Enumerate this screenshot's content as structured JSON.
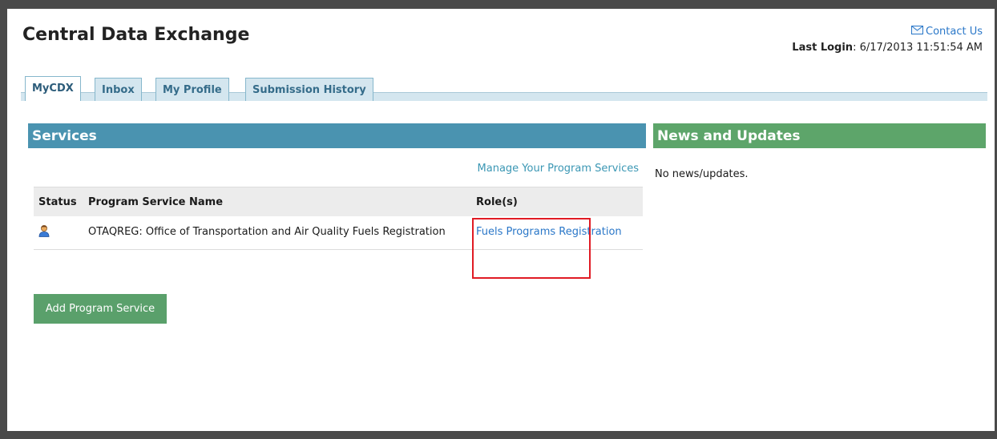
{
  "header": {
    "title": "Central Data Exchange",
    "contact_label": "Contact Us",
    "last_login_label": "Last Login",
    "last_login_value": ": 6/17/2013 11:51:54 AM"
  },
  "tabs": [
    {
      "label": "MyCDX",
      "active": true
    },
    {
      "label": "Inbox",
      "active": false
    },
    {
      "label": "My Profile",
      "active": false
    },
    {
      "label": "Submission History",
      "active": false
    }
  ],
  "services": {
    "heading": "Services",
    "manage_link": "Manage Your Program Services",
    "columns": [
      "Status",
      "Program Service Name",
      "Role(s)"
    ],
    "rows": [
      {
        "status_icon": "user-icon",
        "name": "OTAQREG: Office of Transportation and Air Quality Fuels Registration",
        "roles": [
          "Fuels Programs Registration"
        ]
      }
    ],
    "add_button": "Add Program Service"
  },
  "news": {
    "heading": "News and Updates",
    "empty_text": "No news/updates."
  },
  "colors": {
    "services_header": "#4a93b0",
    "news_header": "#5da56a",
    "add_button": "#5aa06b",
    "link": "#2a77c8",
    "highlight": "#e01b24"
  }
}
